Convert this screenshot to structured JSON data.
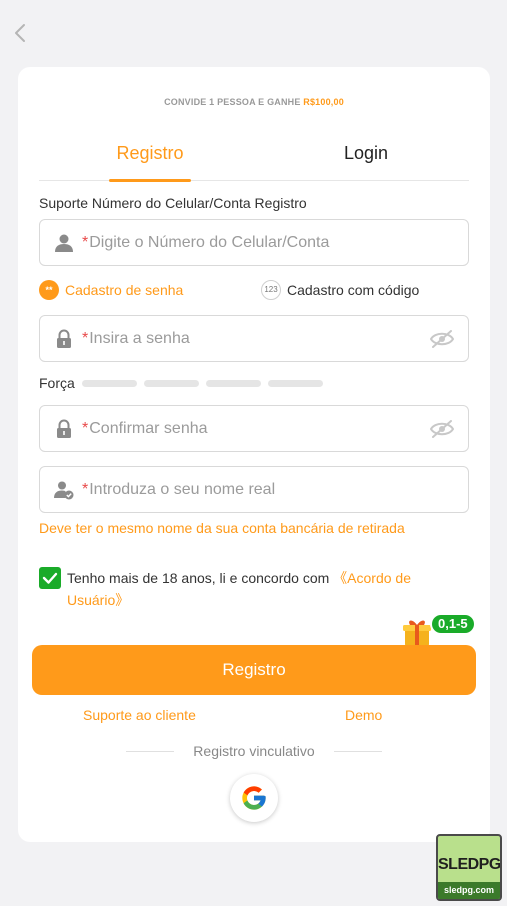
{
  "header": {
    "back_icon": "chevron-left-icon"
  },
  "invite": {
    "text": "CONVIDE 1 PESSOA E GANHE ",
    "amount": "R$100,00"
  },
  "tabs": [
    {
      "label": "Registro",
      "active": true
    },
    {
      "label": "Login",
      "active": false
    }
  ],
  "support_label": "Suporte Número do Celular/Conta Registro",
  "phone_field": {
    "required_mark": "*",
    "placeholder": "Digite o Número do Celular/Conta",
    "icon": "user-icon"
  },
  "modes": {
    "password": {
      "label": "Cadastro de senha",
      "icon_text": "**"
    },
    "code": {
      "label": "Cadastro com código",
      "icon_text": "123"
    }
  },
  "password_field": {
    "required_mark": "*",
    "placeholder": "Insira a senha",
    "icon": "lock-icon",
    "toggle_icon": "eye-off-icon"
  },
  "strength": {
    "label": "Força",
    "level": 0,
    "segments": 4
  },
  "confirm_field": {
    "required_mark": "*",
    "placeholder": "Confirmar senha",
    "icon": "lock-icon",
    "toggle_icon": "eye-off-icon"
  },
  "name_field": {
    "required_mark": "*",
    "placeholder": "Introduza o seu nome real",
    "icon": "user-check-icon"
  },
  "name_hint": "Deve ter o mesmo nome da sua conta bancária de retirada",
  "agreement": {
    "checked": true,
    "text": "Tenho mais de 18 anos, li e concordo com ",
    "link": "《Acordo de Usuário》"
  },
  "gift_badge": {
    "label": "0,1-5",
    "icon": "gift-icon"
  },
  "register_button": "Registro",
  "footer_links": {
    "support": "Suporte ao cliente",
    "demo": "Demo"
  },
  "social": {
    "divider_label": "Registro vinculativo",
    "google_icon": "google-icon"
  },
  "watermark": {
    "title": "SLEDPG",
    "url": "sledpg.com"
  },
  "colors": {
    "accent": "#ff9a1a",
    "success": "#1aab29",
    "required": "#e84a4a",
    "background": "#f2f2f4"
  }
}
